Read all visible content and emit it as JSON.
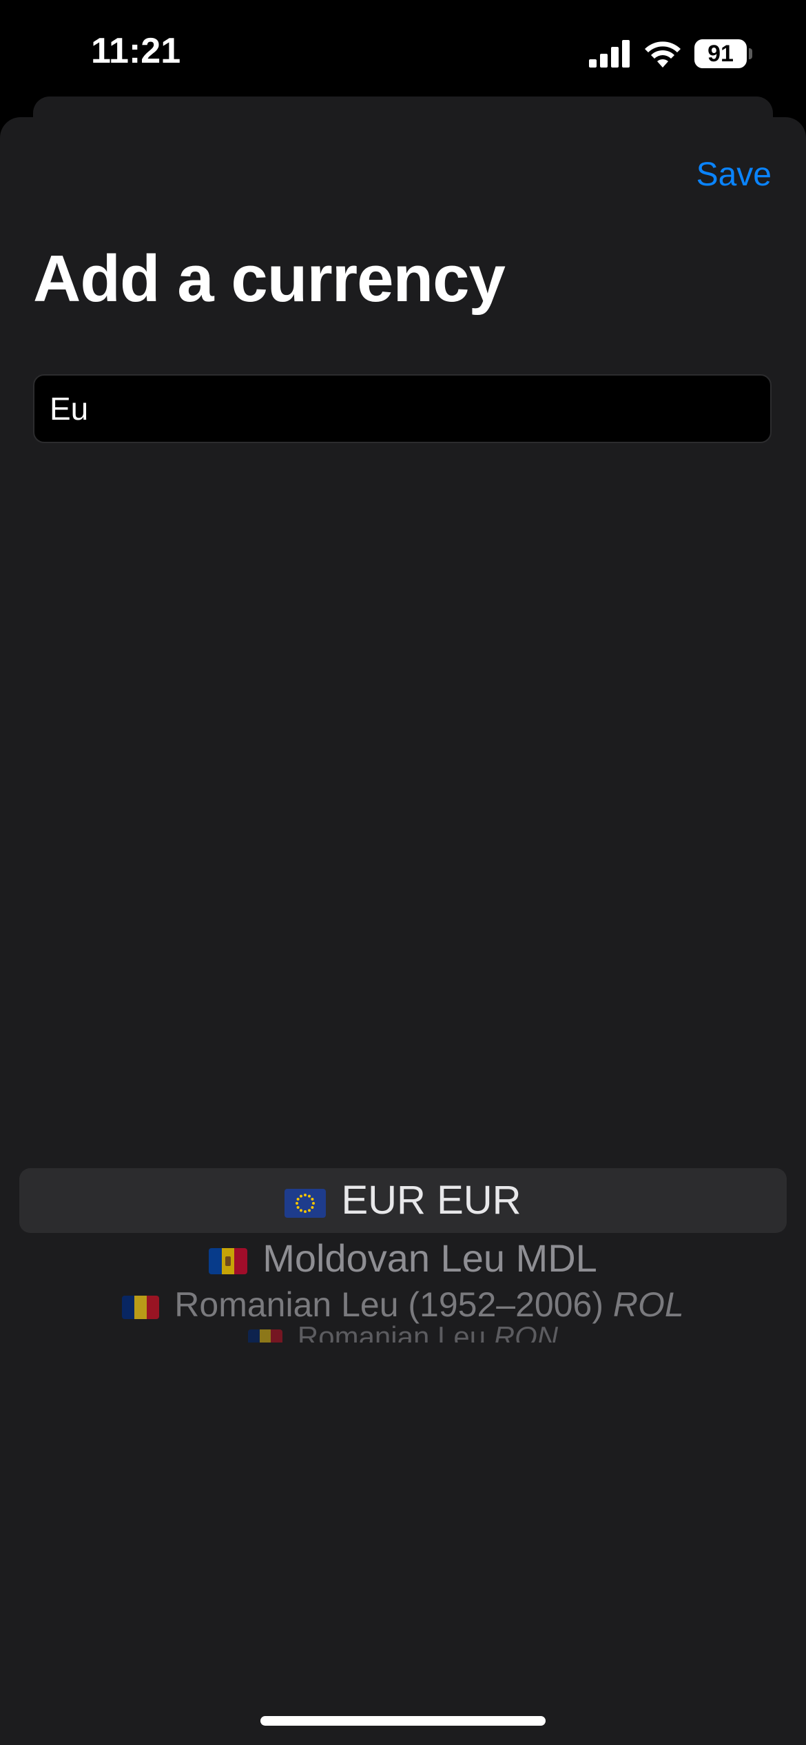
{
  "status_bar": {
    "time": "11:21",
    "battery": "91"
  },
  "sheet": {
    "save_label": "Save",
    "title": "Add a currency",
    "search": {
      "value": "Eu",
      "placeholder": ""
    }
  },
  "picker": {
    "rows": [
      {
        "flag": "eu-flag-icon",
        "name": "EUR",
        "code": "EUR"
      },
      {
        "flag": "moldova-flag-icon",
        "name": "Moldovan Leu",
        "code": "MDL"
      },
      {
        "flag": "romania-flag-icon",
        "name": "Romanian Leu (1952–2006)",
        "code": "ROL"
      },
      {
        "flag": "romania-flag-icon",
        "name": "Romanian Leu",
        "code": "RON"
      }
    ],
    "selected_index": 0
  },
  "colors": {
    "accent": "#0a84ff",
    "sheet_bg": "#1c1c1e",
    "selection_bg": "#2c2c2e"
  }
}
